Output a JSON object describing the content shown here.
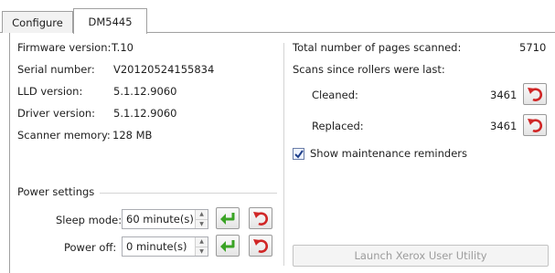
{
  "tabs": [
    {
      "label": "Configure",
      "active": false
    },
    {
      "label": "DM5445",
      "active": true
    }
  ],
  "info": {
    "firmware_label": "Firmware version:",
    "firmware_value": "T.10",
    "serial_label": "Serial number:",
    "serial_value": "V20120524155834",
    "lld_label": "LLD version:",
    "lld_value": "5.1.12.9060",
    "driver_label": "Driver version:",
    "driver_value": "5.1.12.9060",
    "memory_label": "Scanner memory:",
    "memory_value": "128 MB"
  },
  "power": {
    "group_title": "Power settings",
    "sleep_label": "Sleep mode:",
    "sleep_value": "60 minute(s)",
    "poweroff_label": "Power off:",
    "poweroff_value": "0 minute(s)"
  },
  "counters": {
    "total_label": "Total number of pages scanned:",
    "total_value": "5710",
    "since_label": "Scans since rollers were last:",
    "cleaned_label": "Cleaned:",
    "cleaned_value": "3461",
    "replaced_label": "Replaced:",
    "replaced_value": "3461"
  },
  "reminders": {
    "label": "Show maintenance reminders",
    "checked": true
  },
  "launch_button": "Launch Xerox User Utility",
  "colors": {
    "apply_icon": "#3aa325",
    "reset_icon": "#d02626"
  },
  "icons": [
    "apply-arrow-icon",
    "reset-arrow-icon",
    "spin-up-icon",
    "spin-down-icon",
    "checkmark-icon"
  ]
}
